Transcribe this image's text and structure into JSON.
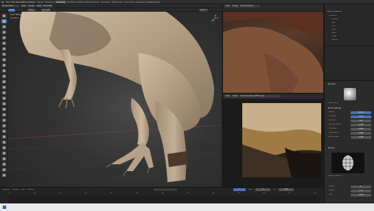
{
  "topbar": {
    "menus": [
      "File",
      "Edit",
      "Render",
      "Window",
      "Help"
    ],
    "tabs": [
      "Layout",
      "Modeling",
      "Sculpting",
      "UV Editing",
      "Texture Paint",
      "Shading",
      "Animation",
      "Rendering",
      "Compositing",
      "Geometry Nodes",
      "Scripting"
    ],
    "active_tab": "Sculpting"
  },
  "viewport": {
    "mode": "Sculpt Mode",
    "view_label": "User Perspective",
    "object_label": "(1) Dino",
    "header_chips": [
      "View",
      "Sculpt",
      "Mask",
      "Face Sets",
      "Brush",
      "Draw",
      "Radius",
      "Strength",
      "Options"
    ]
  },
  "render_view": {
    "header_chips": [
      "View",
      "Image",
      "Render Result"
    ]
  },
  "image_editor": {
    "header_chips": [
      "View",
      "Image",
      "4K_Dino_Body_Diffuse.png"
    ]
  },
  "outliner": {
    "title": "Scene Collection",
    "items": [
      "Collection",
      "Camera",
      "Light",
      "Dino",
      "Eyes",
      "Teeth",
      "Claws",
      "Ground"
    ]
  },
  "properties": {
    "section_brush": "Brushes",
    "section_settings": "Brush Settings",
    "brush_name": "Draw Sharp",
    "rows": [
      {
        "label": "Radius",
        "value": "120 px"
      },
      {
        "label": "Strength",
        "value": "0.500"
      },
      {
        "label": "Direction",
        "value": "Add"
      },
      {
        "label": "Normal Radius",
        "value": "0.500"
      },
      {
        "label": "Hardness",
        "value": "0.000"
      },
      {
        "label": "Autosmooth",
        "value": "0.000"
      },
      {
        "label": "Plane Offset",
        "value": "0.000"
      }
    ],
    "section_texture": "Texture",
    "texture_name": "Alpha_Scales_01",
    "stroke_rows": [
      {
        "label": "Angle",
        "value": "0°"
      },
      {
        "label": "Offset",
        "value": "0 m"
      },
      {
        "label": "Size",
        "value": "1.000"
      }
    ]
  },
  "timeline": {
    "menus": [
      "Playback",
      "Keying",
      "View",
      "Marker"
    ],
    "frame_current": "1",
    "start_label": "Start",
    "start": "1",
    "end_label": "End",
    "end": "250",
    "ticks": [
      "0",
      "20",
      "40",
      "60",
      "80",
      "100",
      "120",
      "140",
      "160",
      "180",
      "200",
      "220",
      "240"
    ]
  },
  "colors": {
    "accent": "#4772b3",
    "skin": "#c9b49a",
    "viewport_bg": "#333333"
  },
  "icons": [
    "select-icon",
    "draw-brush-icon",
    "clay-strips-icon",
    "smooth-brush-icon",
    "grab-brush-icon",
    "mask-brush-icon",
    "move-icon",
    "rotate-icon"
  ]
}
